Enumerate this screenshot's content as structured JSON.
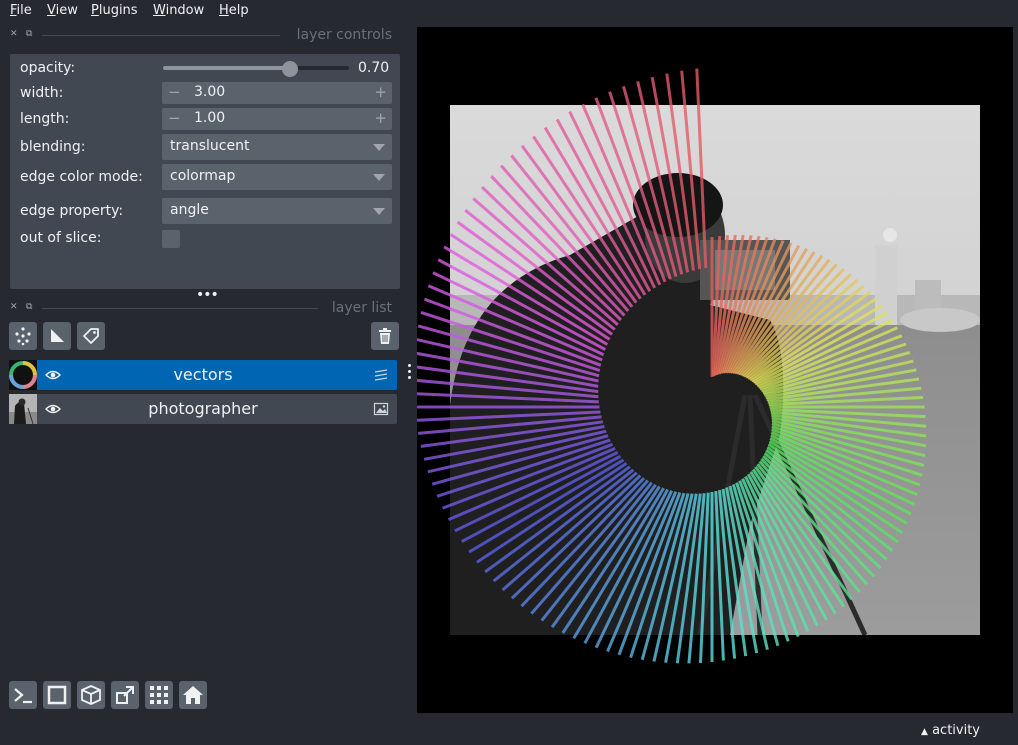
{
  "menu": [
    {
      "key": "F",
      "rest": "ile"
    },
    {
      "key": "V",
      "rest": "iew"
    },
    {
      "key": "P",
      "rest": "lugins"
    },
    {
      "key": "W",
      "rest": "indow"
    },
    {
      "key": "H",
      "rest": "elp"
    }
  ],
  "layer_controls": {
    "title": "layer controls",
    "opacity_label": "opacity:",
    "opacity_value": "0.70",
    "opacity_fraction": 0.7,
    "width_label": "width:",
    "width_value": "3.00",
    "length_label": "length:",
    "length_value": "1.00",
    "blending_label": "blending:",
    "blending_value": "translucent",
    "edge_color_mode_label": "edge color mode:",
    "edge_color_mode_value": "colormap",
    "edge_property_label": "edge property:",
    "edge_property_value": "angle",
    "out_of_slice_label": "out of slice:",
    "out_of_slice_checked": false
  },
  "layer_list": {
    "title": "layer list",
    "layers": [
      {
        "name": "vectors",
        "selected": true,
        "visible": true,
        "type_icon": "vectors-icon"
      },
      {
        "name": "photographer",
        "selected": false,
        "visible": true,
        "type_icon": "image-icon"
      }
    ]
  },
  "status": {
    "activity_label": "activity"
  },
  "colors": {
    "background": "#262930",
    "panel": "#414851",
    "control": "#5a626c",
    "selection": "#0066b3",
    "text": "#f0f1f2"
  }
}
